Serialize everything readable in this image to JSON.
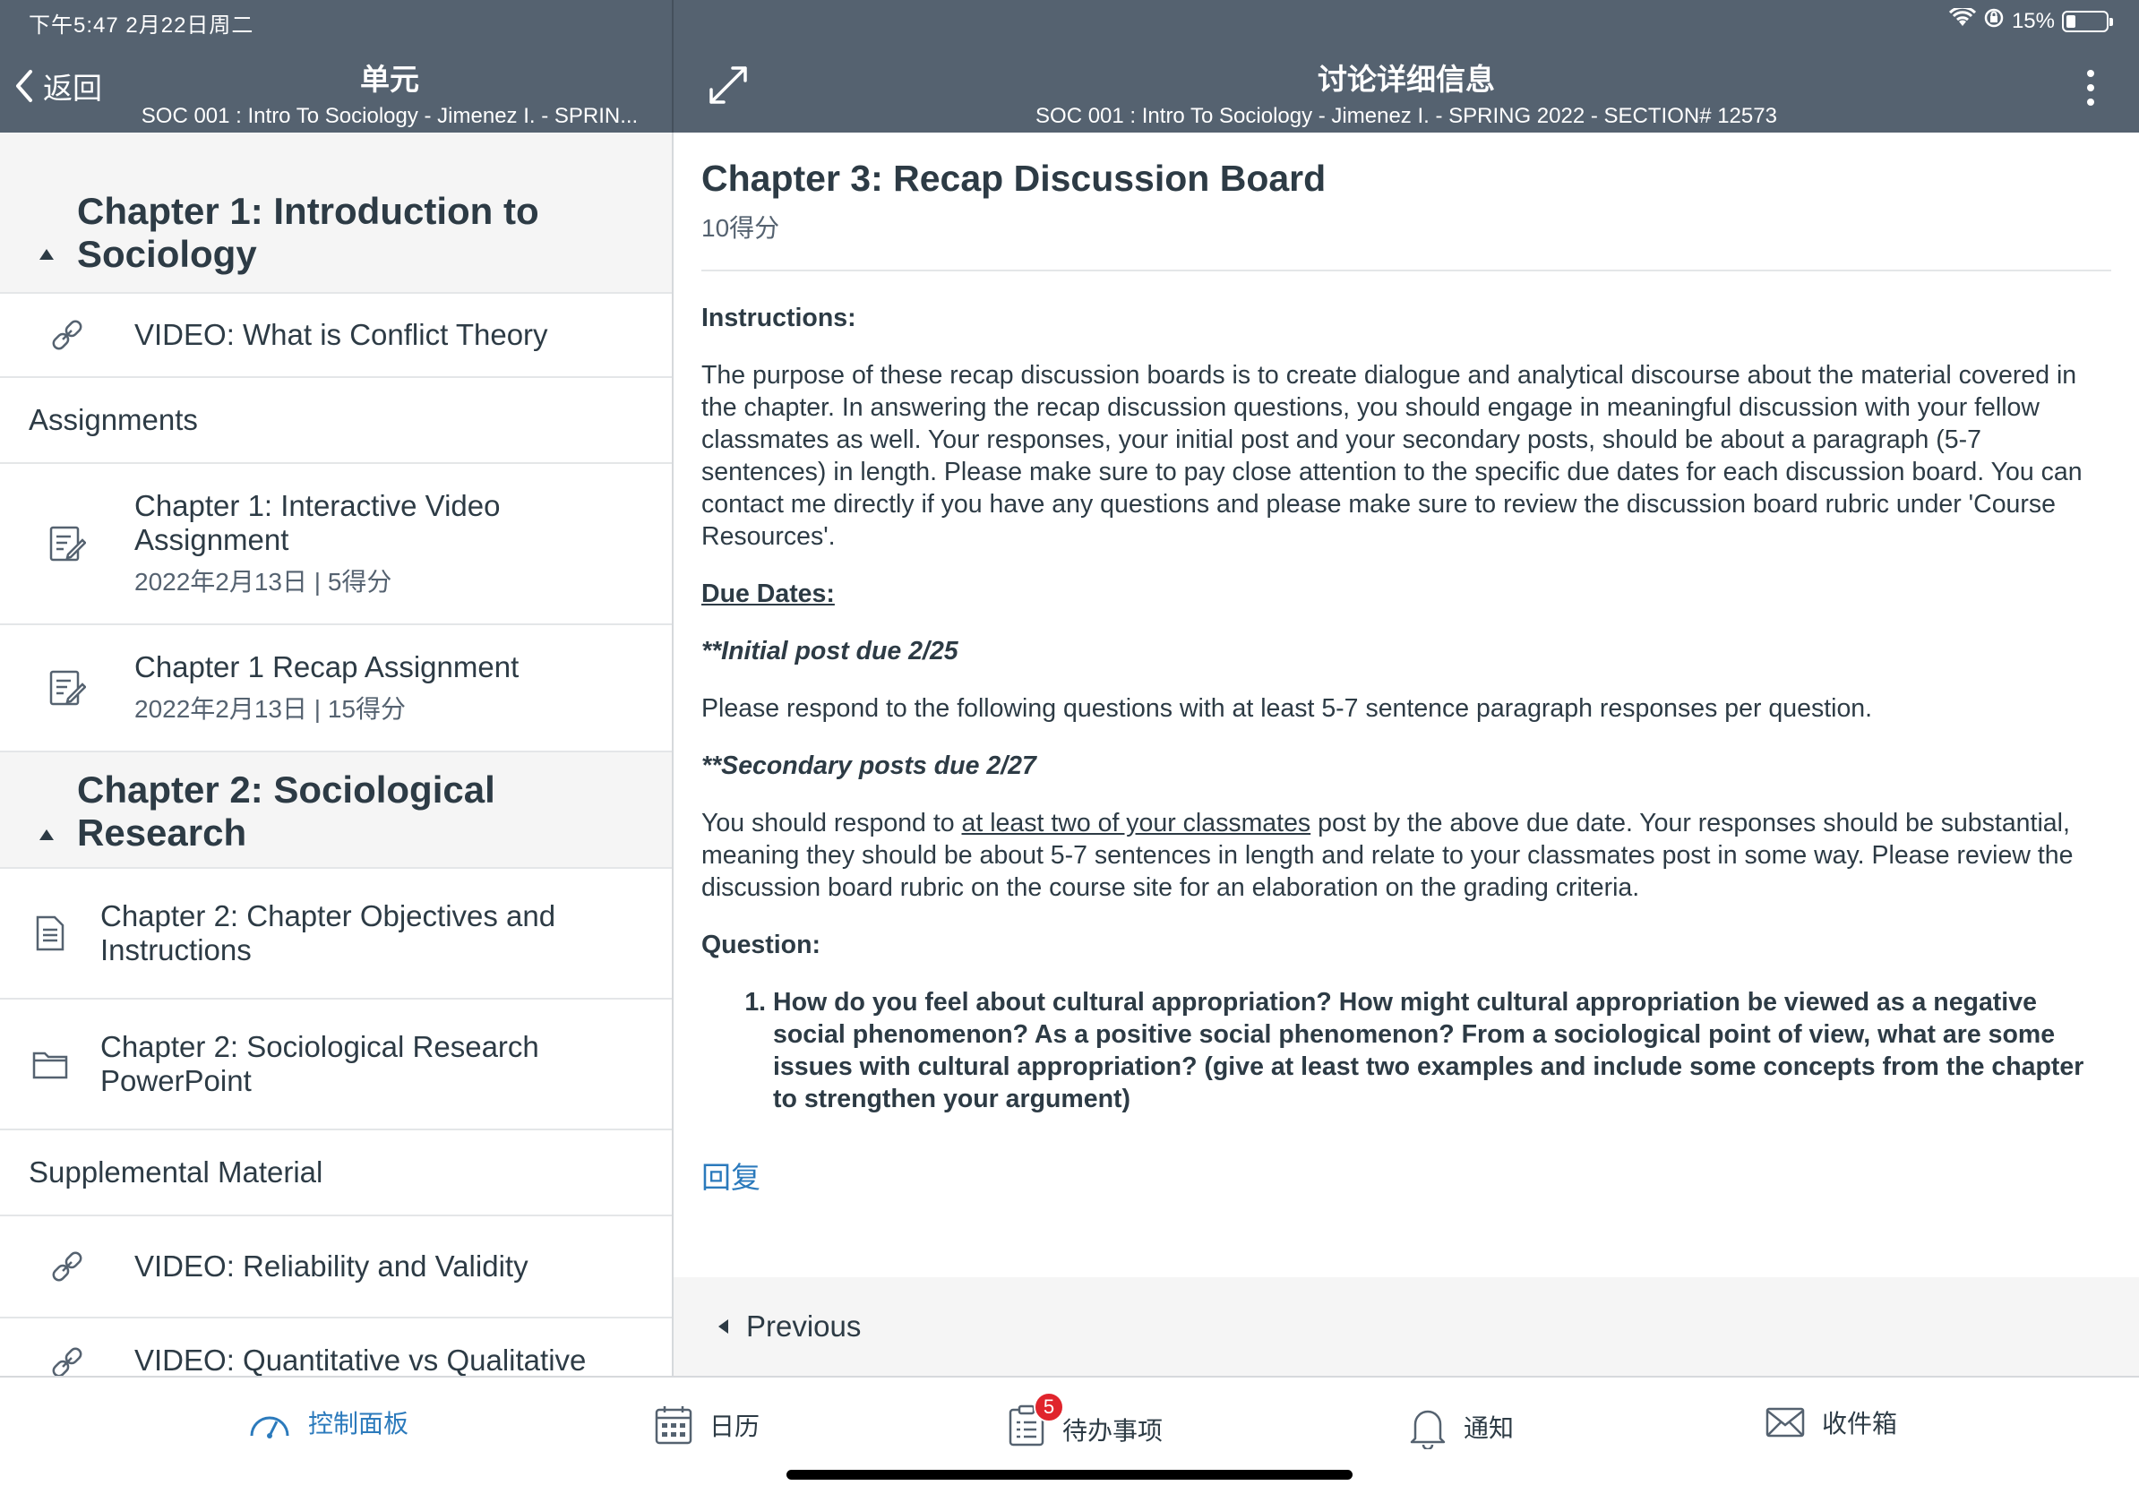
{
  "status": {
    "time": "下午5:47   2月22日周二",
    "battery": "15%",
    "battery_level": 0.15
  },
  "left_header": {
    "back": "返回",
    "title": "单元",
    "subtitle": "SOC 001 : Intro To Sociology - Jimenez I. - SPRIN..."
  },
  "right_header": {
    "title": "讨论详细信息",
    "subtitle": "SOC 001 : Intro To Sociology - Jimenez I. - SPRING 2022 - SECTION# 12573"
  },
  "modules": {
    "ch1": "Chapter 1: Introduction to Sociology",
    "ch1_items": {
      "video_conflict": "VIDEO: What is Conflict Theory",
      "assignments_header": "Assignments",
      "a1_title_l1": "Chapter 1: Interactive Video",
      "a1_title_l2": "Assignment",
      "a1_meta": "2022年2月13日 | 5得分",
      "a2_title": "Chapter 1 Recap Assignment",
      "a2_meta": "2022年2月13日 | 15得分"
    },
    "ch2": "Chapter 2: Sociological Research",
    "ch2_items": {
      "obj_l1": "Chapter 2: Chapter Objectives and",
      "obj_l2": "Instructions",
      "ppt_l1": "Chapter 2: Sociological Research",
      "ppt_l2": "PowerPoint",
      "supp_header": "Supplemental Material",
      "video_reliability": "VIDEO: Reliability and Validity",
      "video_quant": "VIDEO: Quantitative vs Qualitative"
    }
  },
  "discussion": {
    "title": "Chapter 3: Recap Discussion Board",
    "points": "10得分",
    "instructions_label": "Instructions:",
    "instructions_text": "The purpose of these recap discussion boards is to create dialogue and analytical discourse about the material covered in the chapter. In answering the recap discussion questions, you should engage in meaningful discussion with your fellow classmates as well. Your responses, your initial post and your secondary posts,  should be about a paragraph (5-7 sentences) in length. Please make sure to pay close attention to the specific due dates for each discussion board. You can contact me directly if you have any questions and please make sure to review the discussion board rubric under 'Course Resources'.",
    "due_label": "Due Dates: ",
    "initial_post": "**Initial post due 2/25",
    "initial_text": "Please respond to the following questions with at least 5-7 sentence paragraph responses per question.",
    "secondary_post": "**Secondary posts due 2/27",
    "secondary_pre": "You should respond to ",
    "secondary_link": "at least two of your classmates",
    "secondary_post_text": " post by the above due date. Your responses should be substantial, meaning they should be about 5-7 sentences in length and relate to your classmates post in some way. Please review the discussion board rubric on the course site for an elaboration on the grading criteria.",
    "question_label": "Question:",
    "question_1": "How do you feel about cultural appropriation? How might cultural appropriation be viewed as a negative social phenomenon? As a positive social phenomenon? From a sociological point of view, what are some issues with cultural appropriation? (give at least two examples and include some concepts from the chapter to strengthen your argument)",
    "reply": "回复",
    "previous": "Previous"
  },
  "tabbar": {
    "dashboard": "控制面板",
    "calendar": "日历",
    "todo": "待办事项",
    "todo_badge": "5",
    "notifications": "通知",
    "inbox": "收件箱"
  },
  "colors": {
    "header": "#556270",
    "accent": "#2b7abc",
    "badge": "#e0242c"
  }
}
